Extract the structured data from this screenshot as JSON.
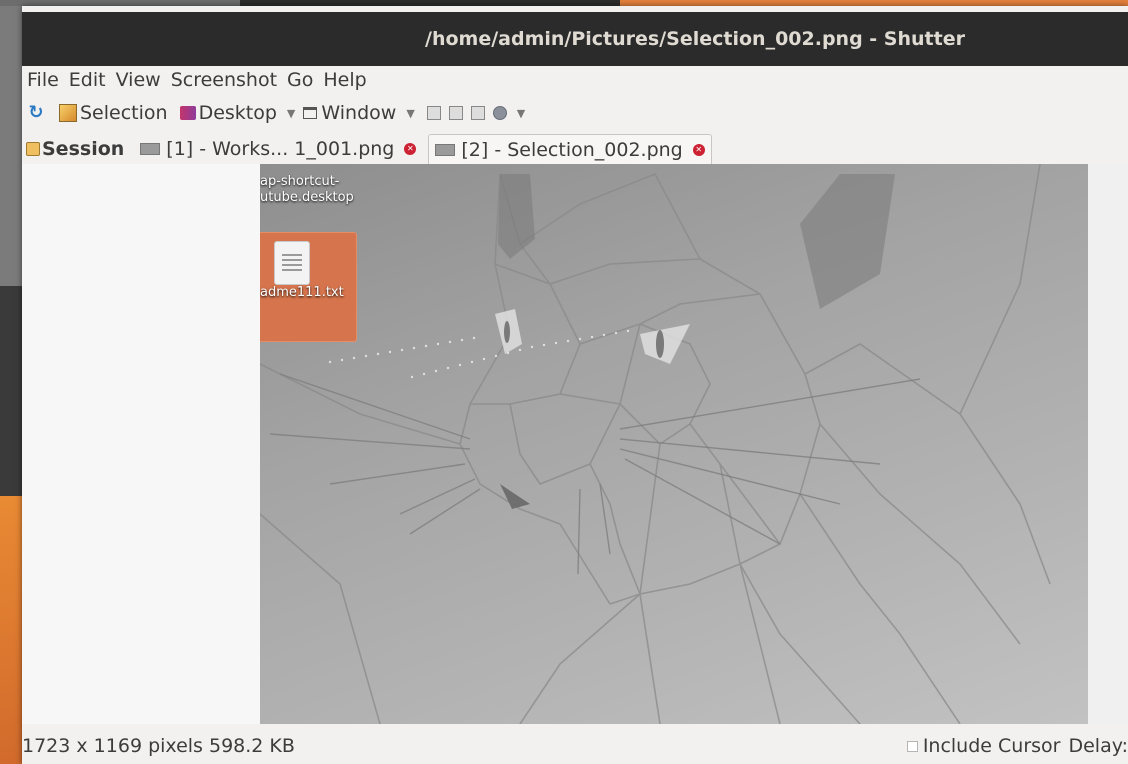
{
  "window": {
    "title": "/home/admin/Pictures/Selection_002.png - Shutter"
  },
  "menu": [
    "File",
    "Edit",
    "View",
    "Screenshot",
    "Go",
    "Help"
  ],
  "toolbar": {
    "refresh_icon": "refresh-icon",
    "selection_label": "Selection",
    "desktop_label": "Desktop",
    "window_label": "Window"
  },
  "tabs": {
    "session_label": "Session",
    "tab1_label": "[1] - Works... 1_001.png",
    "tab2_label": "[2] - Selection_002.png"
  },
  "canvas": {
    "desktop_item1_line1": "ap-shortcut-",
    "desktop_item1_line2": "utube.desktop",
    "desktop_item2": "adme111.txt"
  },
  "status": {
    "info": "1723 x 1169 pixels  598.2 KB",
    "include_cursor_label": "Include Cursor",
    "delay_label": "Delay:"
  },
  "colors": {
    "titlebar": "#2b2b2b",
    "accent_orange": "#d5744d"
  }
}
